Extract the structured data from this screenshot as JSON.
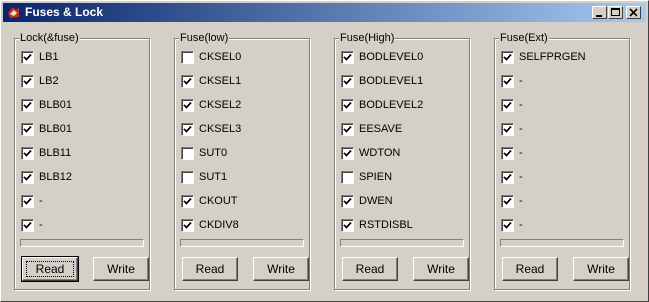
{
  "window": {
    "title": "Fuses & Lock",
    "icon": "app-icon",
    "buttons": [
      "minimize-icon",
      "maximize-icon",
      "close-icon"
    ]
  },
  "groups": [
    {
      "id": "lock",
      "title": "Lock(&fuse)",
      "items": [
        {
          "label": "LB1",
          "checked": true
        },
        {
          "label": "LB2",
          "checked": true
        },
        {
          "label": "BLB01",
          "checked": true
        },
        {
          "label": "BLB01",
          "checked": true
        },
        {
          "label": "BLB11",
          "checked": true
        },
        {
          "label": "BLB12",
          "checked": true
        },
        {
          "label": "-",
          "checked": true
        },
        {
          "label": "-",
          "checked": true
        }
      ],
      "read_label": "Read",
      "write_label": "Write",
      "read_focused": true
    },
    {
      "id": "low",
      "title": "Fuse(low)",
      "items": [
        {
          "label": "CKSEL0",
          "checked": false
        },
        {
          "label": "CKSEL1",
          "checked": true
        },
        {
          "label": "CKSEL2",
          "checked": true
        },
        {
          "label": "CKSEL3",
          "checked": true
        },
        {
          "label": "SUT0",
          "checked": false
        },
        {
          "label": "SUT1",
          "checked": false
        },
        {
          "label": "CKOUT",
          "checked": true
        },
        {
          "label": "CKDIV8",
          "checked": true
        }
      ],
      "read_label": "Read",
      "write_label": "Write",
      "read_focused": false
    },
    {
      "id": "high",
      "title": "Fuse(High)",
      "items": [
        {
          "label": "BODLEVEL0",
          "checked": true
        },
        {
          "label": "BODLEVEL1",
          "checked": true
        },
        {
          "label": "BODLEVEL2",
          "checked": true
        },
        {
          "label": "EESAVE",
          "checked": true
        },
        {
          "label": "WDTON",
          "checked": true
        },
        {
          "label": "SPIEN",
          "checked": false
        },
        {
          "label": "DWEN",
          "checked": true
        },
        {
          "label": "RSTDISBL",
          "checked": true
        }
      ],
      "read_label": "Read",
      "write_label": "Write",
      "read_focused": false
    },
    {
      "id": "ext",
      "title": "Fuse(Ext)",
      "items": [
        {
          "label": "SELFPRGEN",
          "checked": true
        },
        {
          "label": "-",
          "checked": true
        },
        {
          "label": "-",
          "checked": true
        },
        {
          "label": "-",
          "checked": true
        },
        {
          "label": "-",
          "checked": true
        },
        {
          "label": "-",
          "checked": true
        },
        {
          "label": "-",
          "checked": true
        },
        {
          "label": "-",
          "checked": true
        }
      ],
      "read_label": "Read",
      "write_label": "Write",
      "read_focused": false
    }
  ]
}
